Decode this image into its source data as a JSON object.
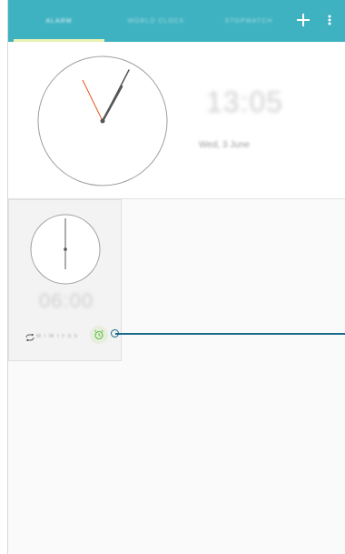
{
  "tabs": [
    {
      "label": "ALARM",
      "active": true
    },
    {
      "label": "WORLD CLOCK",
      "active": false
    },
    {
      "label": "STOPWATCH",
      "active": false
    }
  ],
  "toolbar": {
    "add_icon": "plus-icon",
    "more_icon": "more-vert-icon"
  },
  "clock": {
    "time": "13:05",
    "date": "Wed, 3 June"
  },
  "alarm": {
    "time": "06:00",
    "days": "M T W T F S S",
    "repeat_icon": "repeat-icon",
    "toggle_icon": "alarm-clock-icon"
  },
  "colors": {
    "header": "#3fb2c1",
    "underline": "#eaf3b5",
    "callout": "#1a6a8a",
    "alarm_icon": "#5bbf3a"
  }
}
